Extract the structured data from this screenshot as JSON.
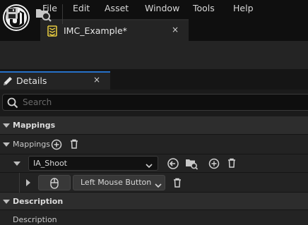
{
  "menu": {
    "items": [
      "File",
      "Edit",
      "Asset",
      "Window",
      "Tools",
      "Help"
    ]
  },
  "document_tab": {
    "label": "IMC_Example*",
    "close": "×"
  },
  "details_tab": {
    "label": "Details",
    "close": "×"
  },
  "search": {
    "placeholder": "Search"
  },
  "categories": {
    "mappings_header": "Mappings",
    "description_header": "Description"
  },
  "mappings": {
    "label": "Mappings",
    "action": {
      "selected": "IA_Shoot"
    },
    "key": {
      "selected": "Left Mouse Button"
    }
  },
  "description": {
    "label": "Description"
  },
  "colors": {
    "accent": "#2671c9",
    "tab_icon": "#e2c73f"
  }
}
